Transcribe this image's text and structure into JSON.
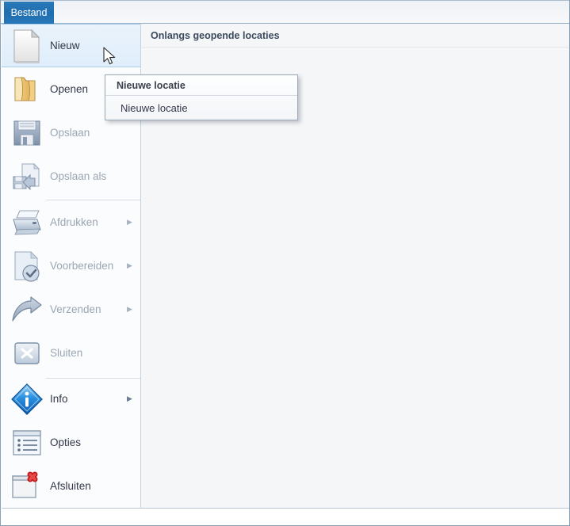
{
  "window": {
    "title": "Bestand menu"
  },
  "tabstrip": {
    "file_tab_label": "Bestand"
  },
  "sidebar": {
    "items": [
      {
        "label": "Nieuw",
        "icon": "new-document-icon",
        "enabled": true,
        "submenu": false,
        "selected": true
      },
      {
        "label": "Openen",
        "icon": "open-folder-icon",
        "enabled": true,
        "submenu": false,
        "selected": false
      },
      {
        "label": "Opslaan",
        "icon": "floppy-disk-icon",
        "enabled": false,
        "submenu": false,
        "selected": false
      },
      {
        "label": "Opslaan als",
        "icon": "save-as-icon",
        "enabled": false,
        "submenu": false,
        "selected": false
      },
      {
        "label": "Afdrukken",
        "icon": "printer-icon",
        "enabled": false,
        "submenu": true,
        "selected": false
      },
      {
        "label": "Voorbereiden",
        "icon": "prepare-check-icon",
        "enabled": false,
        "submenu": true,
        "selected": false
      },
      {
        "label": "Verzenden",
        "icon": "send-arrow-icon",
        "enabled": false,
        "submenu": true,
        "selected": false
      },
      {
        "label": "Sluiten",
        "icon": "close-x-icon",
        "enabled": false,
        "submenu": false,
        "selected": false
      },
      {
        "label": "Info",
        "icon": "info-diamond-icon",
        "enabled": true,
        "submenu": true,
        "selected": false
      },
      {
        "label": "Opties",
        "icon": "options-list-icon",
        "enabled": true,
        "submenu": false,
        "selected": false
      },
      {
        "label": "Afsluiten",
        "icon": "exit-red-x-icon",
        "enabled": true,
        "submenu": false,
        "selected": false
      }
    ],
    "submenu_arrow_glyph": "▶"
  },
  "main": {
    "recent_header": "Onlangs geopende locaties"
  },
  "popup": {
    "header": "Nieuwe locatie",
    "item": "Nieuwe locatie"
  },
  "colors": {
    "tab_blue": "#1f6eb0",
    "selection_blue": "#dfeefb",
    "selection_border": "#a8cdea",
    "panel_bg": "#f5f6f8",
    "sidebar_bg": "#fbfcfd",
    "text_enabled": "#33384a",
    "text_disabled": "#9ba6b4",
    "header_text": "#3c4a5e"
  }
}
